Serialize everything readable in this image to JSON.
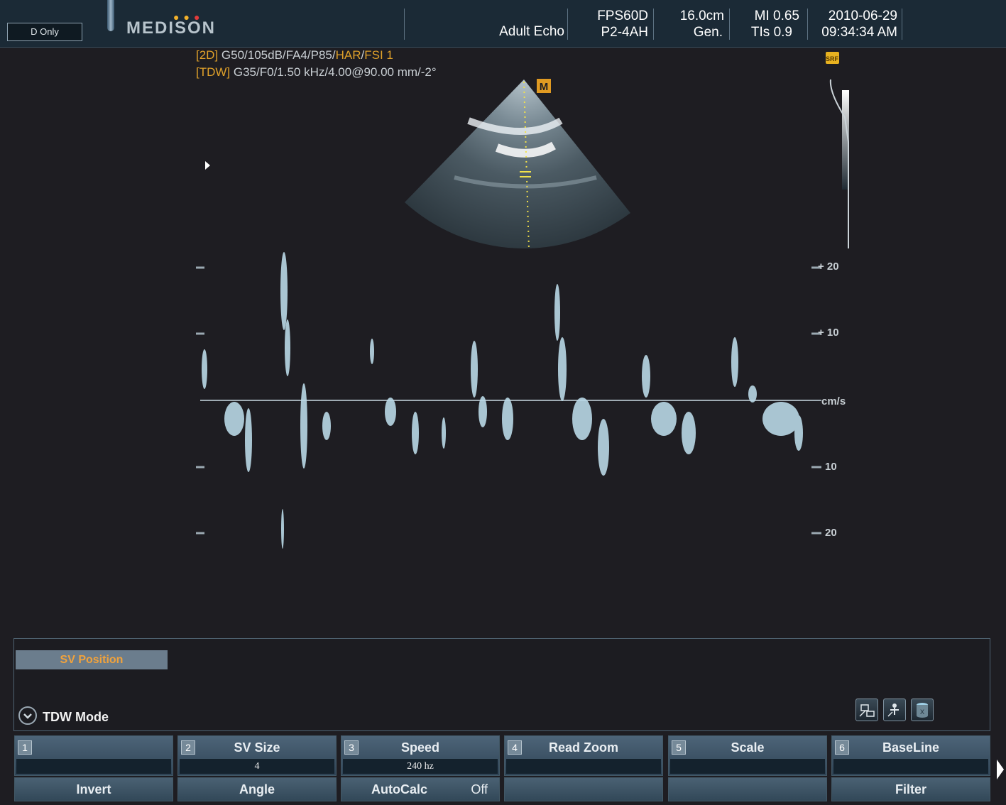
{
  "header": {
    "mode_label": "D Only",
    "logo": "MEDISON",
    "exam": "Adult Echo",
    "fps": "FPS60D",
    "view": "P2-4AH",
    "depth": "16.0cm",
    "freq": "Gen.",
    "mi": "MI 0.65",
    "tis": "TIs 0.9",
    "date": "2010-06-29",
    "time": "09:34:34 AM"
  },
  "params": {
    "line1_tag": "[2D]",
    "line1_a": " G50/105dB/FA4/P85/",
    "line1_har": "HAR",
    "line1_sep": "/",
    "line1_fsi": "FSI 1",
    "line2_tag": "[TDW]",
    "line2_rest": " G35/F0/1.50 kHz/4.00@90.00 mm/-2°"
  },
  "image": {
    "m_marker": "M",
    "grayscale_bar_label": "SRF",
    "scale_labels": [
      "+ 20",
      "+ 10",
      "cm/s",
      "10",
      "20"
    ]
  },
  "panel": {
    "sv_position": "SV Position",
    "mode_title": "TDW Mode",
    "tool_icons": [
      "network-icon",
      "patient-icon",
      "storage-icon"
    ]
  },
  "softkeys": [
    {
      "num": "1",
      "title": "",
      "value": ""
    },
    {
      "num": "2",
      "title": "SV Size",
      "value": "4"
    },
    {
      "num": "3",
      "title": "Speed",
      "value": "240 hz"
    },
    {
      "num": "4",
      "title": "Read Zoom",
      "value": ""
    },
    {
      "num": "5",
      "title": "Scale",
      "value": ""
    },
    {
      "num": "6",
      "title": "BaseLine",
      "value": ""
    }
  ],
  "bottom_keys": [
    "Invert",
    "Angle",
    "AutoCalc",
    "",
    "",
    "Filter"
  ],
  "autocalc_state": "Off",
  "colors": {
    "accent": "#e0a12a",
    "sample_line": "#f2e14a",
    "orange_sv": "#f0a23c"
  }
}
